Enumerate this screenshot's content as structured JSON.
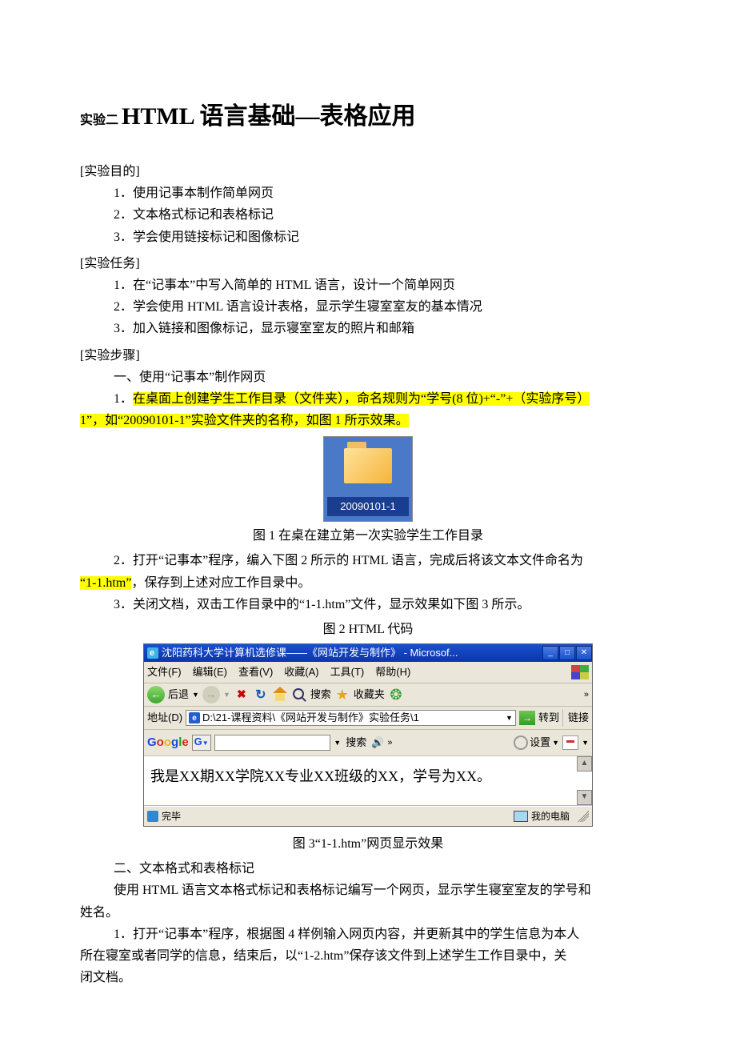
{
  "title_small": "实验二 ",
  "title_big": "HTML 语言基础—表格应用",
  "sec_purpose_head": "[实验目的]",
  "purpose": [
    "1．使用记事本制作简单网页",
    "2．文本格式标记和表格标记",
    "3．学会使用链接标记和图像标记"
  ],
  "sec_task_head": "[实验任务]",
  "tasks": [
    "1．在“记事本”中写入简单的 HTML 语言，设计一个简单网页",
    "2．学会使用 HTML 语言设计表格，显示学生寝室室友的基本情况",
    "3．加入链接和图像标记，显示寝室室友的照片和邮箱"
  ],
  "sec_steps_head": "[实验步骤]",
  "step_a_head": "一、使用“记事本”制作网页",
  "step1_prefix": "1．",
  "step1_hl": "在桌面上创建学生工作目录（文件夹），命名规则为“学号(8 位)+“-”+（实验序号）",
  "step1_line2_hl_a": "1”，如“20090101-1”实验文件夹的名称，如图 1 所示效果。",
  "folder_label": "20090101-1",
  "fig1_caption": "图 1 在桌在建立第一次实验学生工作目录",
  "step2_a": "2．打开“记事本”程序，编入下图 2 所示的 HTML 语言，完成后将该文本文件命名为",
  "step2_b_hl": "“1-1.htm”",
  "step2_b_rest": "，保存到上述对应工作目录中。",
  "step3": "3．关闭文档，双击工作目录中的“1-1.htm”文件，显示效果如下图 3 所示。",
  "fig2_caption": "图 2 HTML 代码",
  "browser": {
    "title": "沈阳药科大学计算机选修课——《网站开发与制作》 - Microsof...",
    "menu": {
      "file": "文件(F)",
      "edit": "编辑(E)",
      "view": "查看(V)",
      "fav": "收藏(A)",
      "tools": "工具(T)",
      "help": "帮助(H)"
    },
    "toolbar": {
      "back": "后退",
      "search": "搜索",
      "favorites": "收藏夹"
    },
    "address_label": "地址(D)",
    "address_value": "D:\\21-课程资料\\《网站开发与制作》实验任务\\1",
    "go": "转到",
    "links": "链接",
    "google_search": "搜索",
    "google_settings": "设置",
    "content": "我是XX期XX学院XX专业XX班级的XX，学号为XX。",
    "status_done": "完毕",
    "status_zone": "我的电脑"
  },
  "fig3_caption": "图 3“1-1.htm”网页显示效果",
  "step_b_head": "二、文本格式和表格标记",
  "step_b_intro_a": "使用 HTML 语言文本格式标记和表格标记编写一个网页，显示学生寝室室友的学号和",
  "step_b_intro_b": "姓名。",
  "step_b_1_a": "1．打开“记事本”程序，根据图 4 样例输入网页内容，并更新其中的学生信息为本人",
  "step_b_1_b": "所在寝室或者同学的信息，结束后，以“1-2.htm”保存该文件到上述学生工作目录中，关",
  "step_b_1_c": "闭文档。"
}
